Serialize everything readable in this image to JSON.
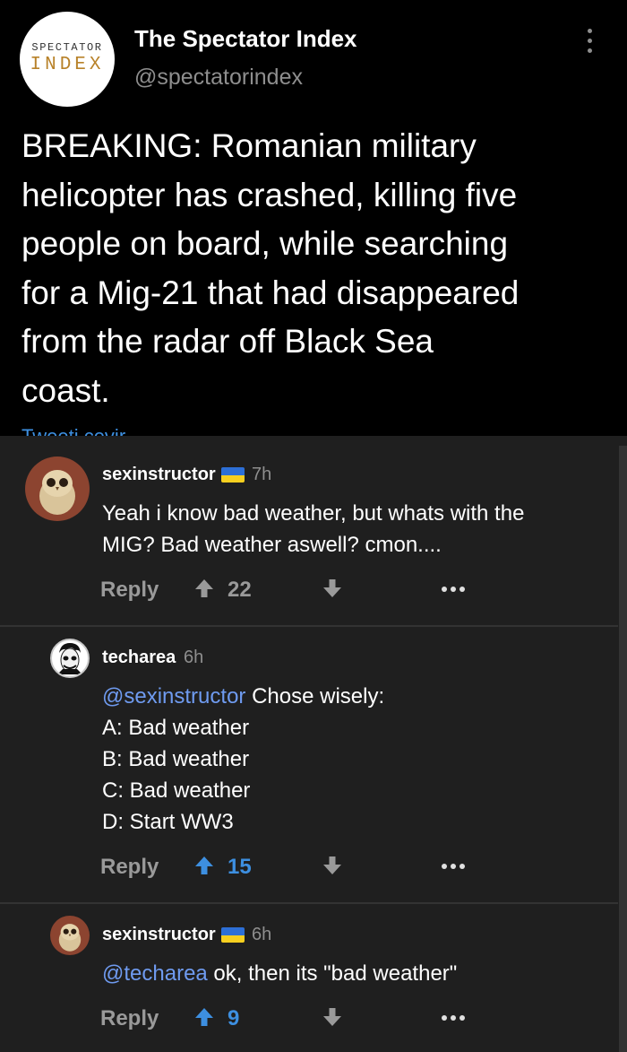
{
  "tweet": {
    "avatar_line1": "SPECTATOR",
    "avatar_line2": "INDEX",
    "name": "The Spectator Index",
    "handle": "@spectatorindex",
    "lines": [
      "BREAKING: Romanian military",
      "helicopter has crashed, killing five",
      "people on board, while searching",
      "for a Mig-21 that had disappeared",
      "from the radar off Black Sea",
      "coast."
    ],
    "footer_cut": "Tweeti çevir"
  },
  "comments": [
    {
      "user": "sexinstructor",
      "has_flag": true,
      "age": "7h",
      "lines": [
        "Yeah i know bad weather, but whats with the",
        "MIG? Bad weather aswell? cmon...."
      ],
      "reply_label": "Reply",
      "score": "22",
      "upvoted": false
    },
    {
      "user": "techarea",
      "has_flag": false,
      "age": "6h",
      "mention": "@sexinstructor",
      "first_line_rest": " Chose wisely:",
      "lines": [
        "A: Bad weather",
        "B: Bad weather",
        "C: Bad weather",
        "D: Start WW3"
      ],
      "reply_label": "Reply",
      "score": "15",
      "upvoted": true
    },
    {
      "user": "sexinstructor",
      "has_flag": true,
      "age": "6h",
      "mention": "@techarea",
      "first_line_rest": " ok, then its \"bad weather\"",
      "reply_label": "Reply",
      "score": "9",
      "upvoted": true
    }
  ],
  "colors": {
    "upvoted": "#3d8fe0",
    "neutral": "#9a9a9a",
    "mention": "#6f9bf0",
    "flag_blue": "#2d6fd6",
    "flag_yellow": "#f7cf1f"
  }
}
